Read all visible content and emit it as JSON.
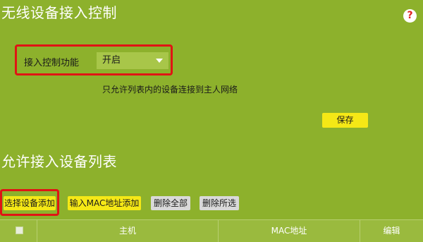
{
  "header": {
    "title": "无线设备接入控制"
  },
  "access_control": {
    "label": "接入控制功能",
    "selected": "开启",
    "description": "只允许列表内的设备连接到主人网络",
    "save_label": "保存"
  },
  "device_list": {
    "title": "允许接入设备列表",
    "buttons": {
      "select_add": "选择设备添加",
      "mac_add": "输入MAC地址添加",
      "delete_all": "删除全部",
      "delete_selected": "删除所选"
    },
    "columns": [
      "主机",
      "MAC地址",
      "编辑"
    ]
  },
  "colors": {
    "background": "#8db12c",
    "highlight": "#e01414",
    "button_primary": "#f5e816",
    "button_secondary": "#d9d9d9"
  }
}
